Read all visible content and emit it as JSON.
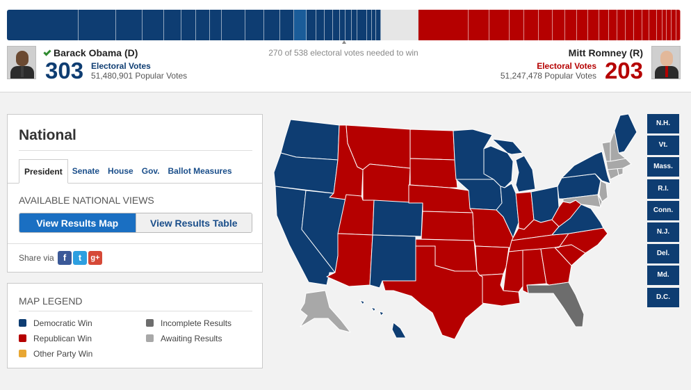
{
  "colors": {
    "democrat": "#0e3d72",
    "republican": "#b50000",
    "other": "#e8a733",
    "incomplete": "#6d6d6d",
    "awaiting": "#a8a8a8",
    "dem_highlight": "#1a5c99"
  },
  "header": {
    "electoral_needed": "270 of 538 electoral votes needed to win",
    "obama": {
      "name": "Barack Obama (D)",
      "electoral_votes": "303",
      "ev_label": "Electoral Votes",
      "popular_votes": "51,480,901 Popular Votes",
      "winner_icon": "check-icon"
    },
    "romney": {
      "name": "Mitt Romney (R)",
      "electoral_votes": "203",
      "ev_label": "Electoral Votes",
      "popular_votes": "51,247,478 Popular Votes"
    }
  },
  "national": {
    "title": "National",
    "tabs": [
      "President",
      "Senate",
      "House",
      "Gov.",
      "Ballot Measures"
    ],
    "active_tab": "President",
    "views_title": "AVAILABLE NATIONAL VIEWS",
    "view_map_label": "View Results Map",
    "view_table_label": "View Results Table",
    "share_label": "Share via",
    "share_icons": [
      "facebook-icon",
      "twitter-icon",
      "google-plus-icon"
    ]
  },
  "legend": {
    "title": "MAP LEGEND",
    "items": [
      {
        "label": "Democratic Win",
        "color": "#0e3d72"
      },
      {
        "label": "Republican Win",
        "color": "#b50000"
      },
      {
        "label": "Other Party Win",
        "color": "#e8a733"
      },
      {
        "label": "Incomplete Results",
        "color": "#6d6d6d"
      },
      {
        "label": "Awaiting Results",
        "color": "#a8a8a8"
      }
    ]
  },
  "small_states": [
    "N.H.",
    "Vt.",
    "Mass.",
    "R.I.",
    "Conn.",
    "N.J.",
    "Del.",
    "Md.",
    "D.C."
  ],
  "small_state_results": [
    "dem",
    "dem",
    "dem",
    "dem",
    "dem",
    "dem",
    "dem",
    "dem",
    "dem"
  ],
  "states": [
    {
      "abbr": "WA",
      "result": "dem"
    },
    {
      "abbr": "OR",
      "result": "dem"
    },
    {
      "abbr": "CA",
      "result": "dem"
    },
    {
      "abbr": "NV",
      "result": "dem"
    },
    {
      "abbr": "ID",
      "result": "rep"
    },
    {
      "abbr": "MT",
      "result": "rep"
    },
    {
      "abbr": "WY",
      "result": "rep"
    },
    {
      "abbr": "UT",
      "result": "rep"
    },
    {
      "abbr": "AZ",
      "result": "rep"
    },
    {
      "abbr": "CO",
      "result": "dem"
    },
    {
      "abbr": "NM",
      "result": "dem"
    },
    {
      "abbr": "ND",
      "result": "rep"
    },
    {
      "abbr": "SD",
      "result": "rep"
    },
    {
      "abbr": "NE",
      "result": "rep"
    },
    {
      "abbr": "KS",
      "result": "rep"
    },
    {
      "abbr": "OK",
      "result": "rep"
    },
    {
      "abbr": "TX",
      "result": "rep"
    },
    {
      "abbr": "MN",
      "result": "dem"
    },
    {
      "abbr": "IA",
      "result": "dem"
    },
    {
      "abbr": "MO",
      "result": "rep"
    },
    {
      "abbr": "AR",
      "result": "rep"
    },
    {
      "abbr": "LA",
      "result": "rep"
    },
    {
      "abbr": "WI",
      "result": "dem"
    },
    {
      "abbr": "IL",
      "result": "dem"
    },
    {
      "abbr": "MI",
      "result": "dem"
    },
    {
      "abbr": "IN",
      "result": "rep"
    },
    {
      "abbr": "OH",
      "result": "dem"
    },
    {
      "abbr": "KY",
      "result": "rep"
    },
    {
      "abbr": "TN",
      "result": "rep"
    },
    {
      "abbr": "MS",
      "result": "rep"
    },
    {
      "abbr": "AL",
      "result": "rep"
    },
    {
      "abbr": "GA",
      "result": "rep"
    },
    {
      "abbr": "FL",
      "result": "incomplete"
    },
    {
      "abbr": "SC",
      "result": "rep"
    },
    {
      "abbr": "NC",
      "result": "rep"
    },
    {
      "abbr": "VA",
      "result": "dem"
    },
    {
      "abbr": "WV",
      "result": "rep"
    },
    {
      "abbr": "PA",
      "result": "dem"
    },
    {
      "abbr": "NY",
      "result": "dem"
    },
    {
      "abbr": "ME",
      "result": "dem"
    },
    {
      "abbr": "AK",
      "result": "awaiting"
    },
    {
      "abbr": "HI",
      "result": "dem"
    }
  ],
  "bar_segments": [
    {
      "ev": 55,
      "party": "dem"
    },
    {
      "ev": 29,
      "party": "dem"
    },
    {
      "ev": 20,
      "party": "dem"
    },
    {
      "ev": 16,
      "party": "dem"
    },
    {
      "ev": 13,
      "party": "dem"
    },
    {
      "ev": 11,
      "party": "dem"
    },
    {
      "ev": 10,
      "party": "dem"
    },
    {
      "ev": 9,
      "party": "dem"
    },
    {
      "ev": 18,
      "party": "dem"
    },
    {
      "ev": 14,
      "party": "dem"
    },
    {
      "ev": 12,
      "party": "dem"
    },
    {
      "ev": 10,
      "party": "dem"
    },
    {
      "ev": 9,
      "party": "dem_highlight"
    },
    {
      "ev": 7,
      "party": "dem"
    },
    {
      "ev": 6,
      "party": "dem"
    },
    {
      "ev": 6,
      "party": "dem"
    },
    {
      "ev": 5,
      "party": "dem"
    },
    {
      "ev": 4,
      "party": "dem"
    },
    {
      "ev": 4,
      "party": "dem"
    },
    {
      "ev": 4,
      "party": "dem"
    },
    {
      "ev": 7,
      "party": "dem"
    },
    {
      "ev": 3,
      "party": "dem"
    },
    {
      "ev": 3,
      "party": "dem"
    },
    {
      "ev": 3,
      "party": "dem"
    },
    {
      "ev": 29,
      "party": "undecided"
    },
    {
      "ev": 38,
      "party": "rep"
    },
    {
      "ev": 16,
      "party": "rep"
    },
    {
      "ev": 15,
      "party": "rep"
    },
    {
      "ev": 11,
      "party": "rep"
    },
    {
      "ev": 11,
      "party": "rep"
    },
    {
      "ev": 10,
      "party": "rep"
    },
    {
      "ev": 9,
      "party": "rep"
    },
    {
      "ev": 9,
      "party": "rep"
    },
    {
      "ev": 8,
      "party": "rep"
    },
    {
      "ev": 8,
      "party": "rep"
    },
    {
      "ev": 7,
      "party": "rep"
    },
    {
      "ev": 6,
      "party": "rep"
    },
    {
      "ev": 6,
      "party": "rep"
    },
    {
      "ev": 6,
      "party": "rep"
    },
    {
      "ev": 6,
      "party": "rep"
    },
    {
      "ev": 5,
      "party": "rep"
    },
    {
      "ev": 5,
      "party": "rep"
    },
    {
      "ev": 4,
      "party": "rep"
    },
    {
      "ev": 3,
      "party": "rep"
    },
    {
      "ev": 3,
      "party": "rep"
    },
    {
      "ev": 3,
      "party": "rep"
    },
    {
      "ev": 3,
      "party": "rep"
    }
  ]
}
